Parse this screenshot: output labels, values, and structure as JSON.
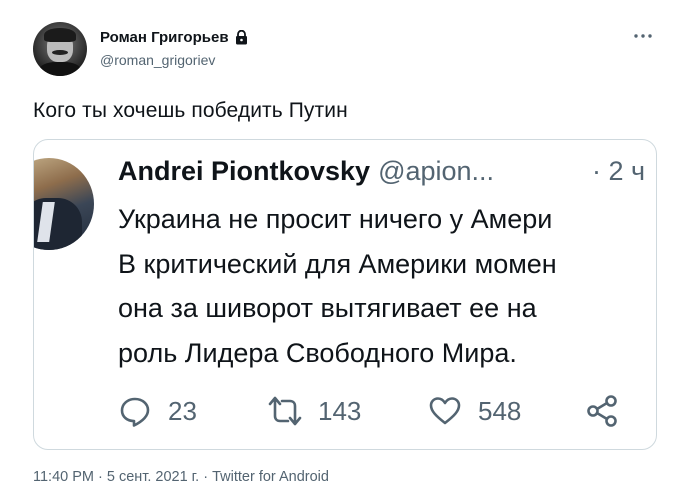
{
  "author": {
    "display_name": "Роман Григорьев",
    "handle": "@roman_grigoriev"
  },
  "tweet_text": "Кого ты хочешь победить Путин",
  "embedded": {
    "name": "Andrei Piontkovsky",
    "handle": "@apion...",
    "time": "· 2 ч",
    "lines": [
      "Украина не просит ничего у Амери",
      "В критический для Америки момен",
      "она за шиворот вытягивает ее на",
      "роль Лидера Свободного Мира."
    ],
    "replies": "23",
    "retweets": "143",
    "likes": "548"
  },
  "meta": "11:40 PM · 5 сент. 2021 г. · Twitter for Android",
  "icons": [
    "lock-icon",
    "more-icon",
    "reply-icon",
    "retweet-icon",
    "like-icon",
    "share-icon"
  ]
}
